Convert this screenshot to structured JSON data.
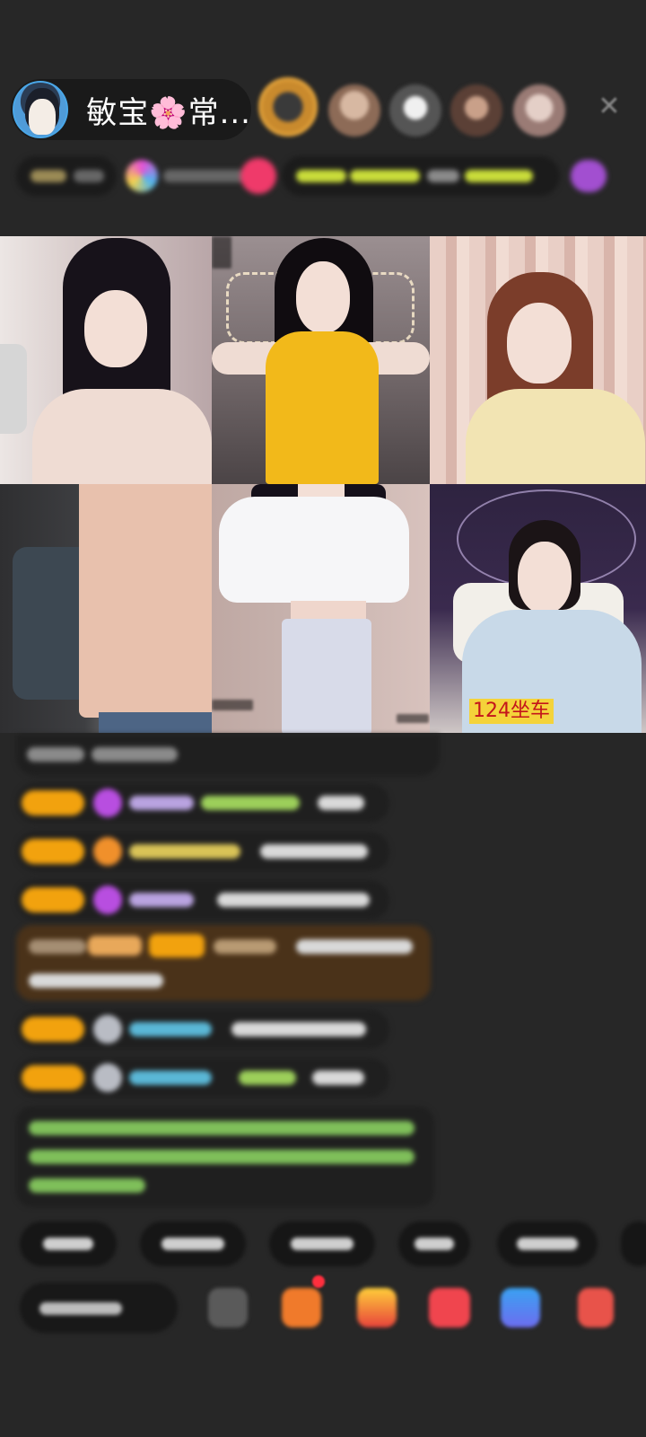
{
  "header": {
    "host_name": "敏宝🌸常...",
    "viewer_avatars": [
      "viewer-avatar-1",
      "viewer-avatar-2",
      "viewer-avatar-3",
      "viewer-avatar-4",
      "viewer-avatar-5"
    ],
    "close_icon": "close-icon"
  },
  "video_grid": {
    "tiles": [
      {
        "id": "tile-1"
      },
      {
        "id": "tile-2"
      },
      {
        "id": "tile-3"
      },
      {
        "id": "tile-4"
      },
      {
        "id": "tile-5"
      },
      {
        "id": "tile-6",
        "label": "124坐车"
      }
    ]
  },
  "colors": {
    "background": "#272727",
    "badge": "#f2a20e",
    "tile_label_bg": "#f4d33a",
    "tile_label_text": "#c4151b"
  }
}
